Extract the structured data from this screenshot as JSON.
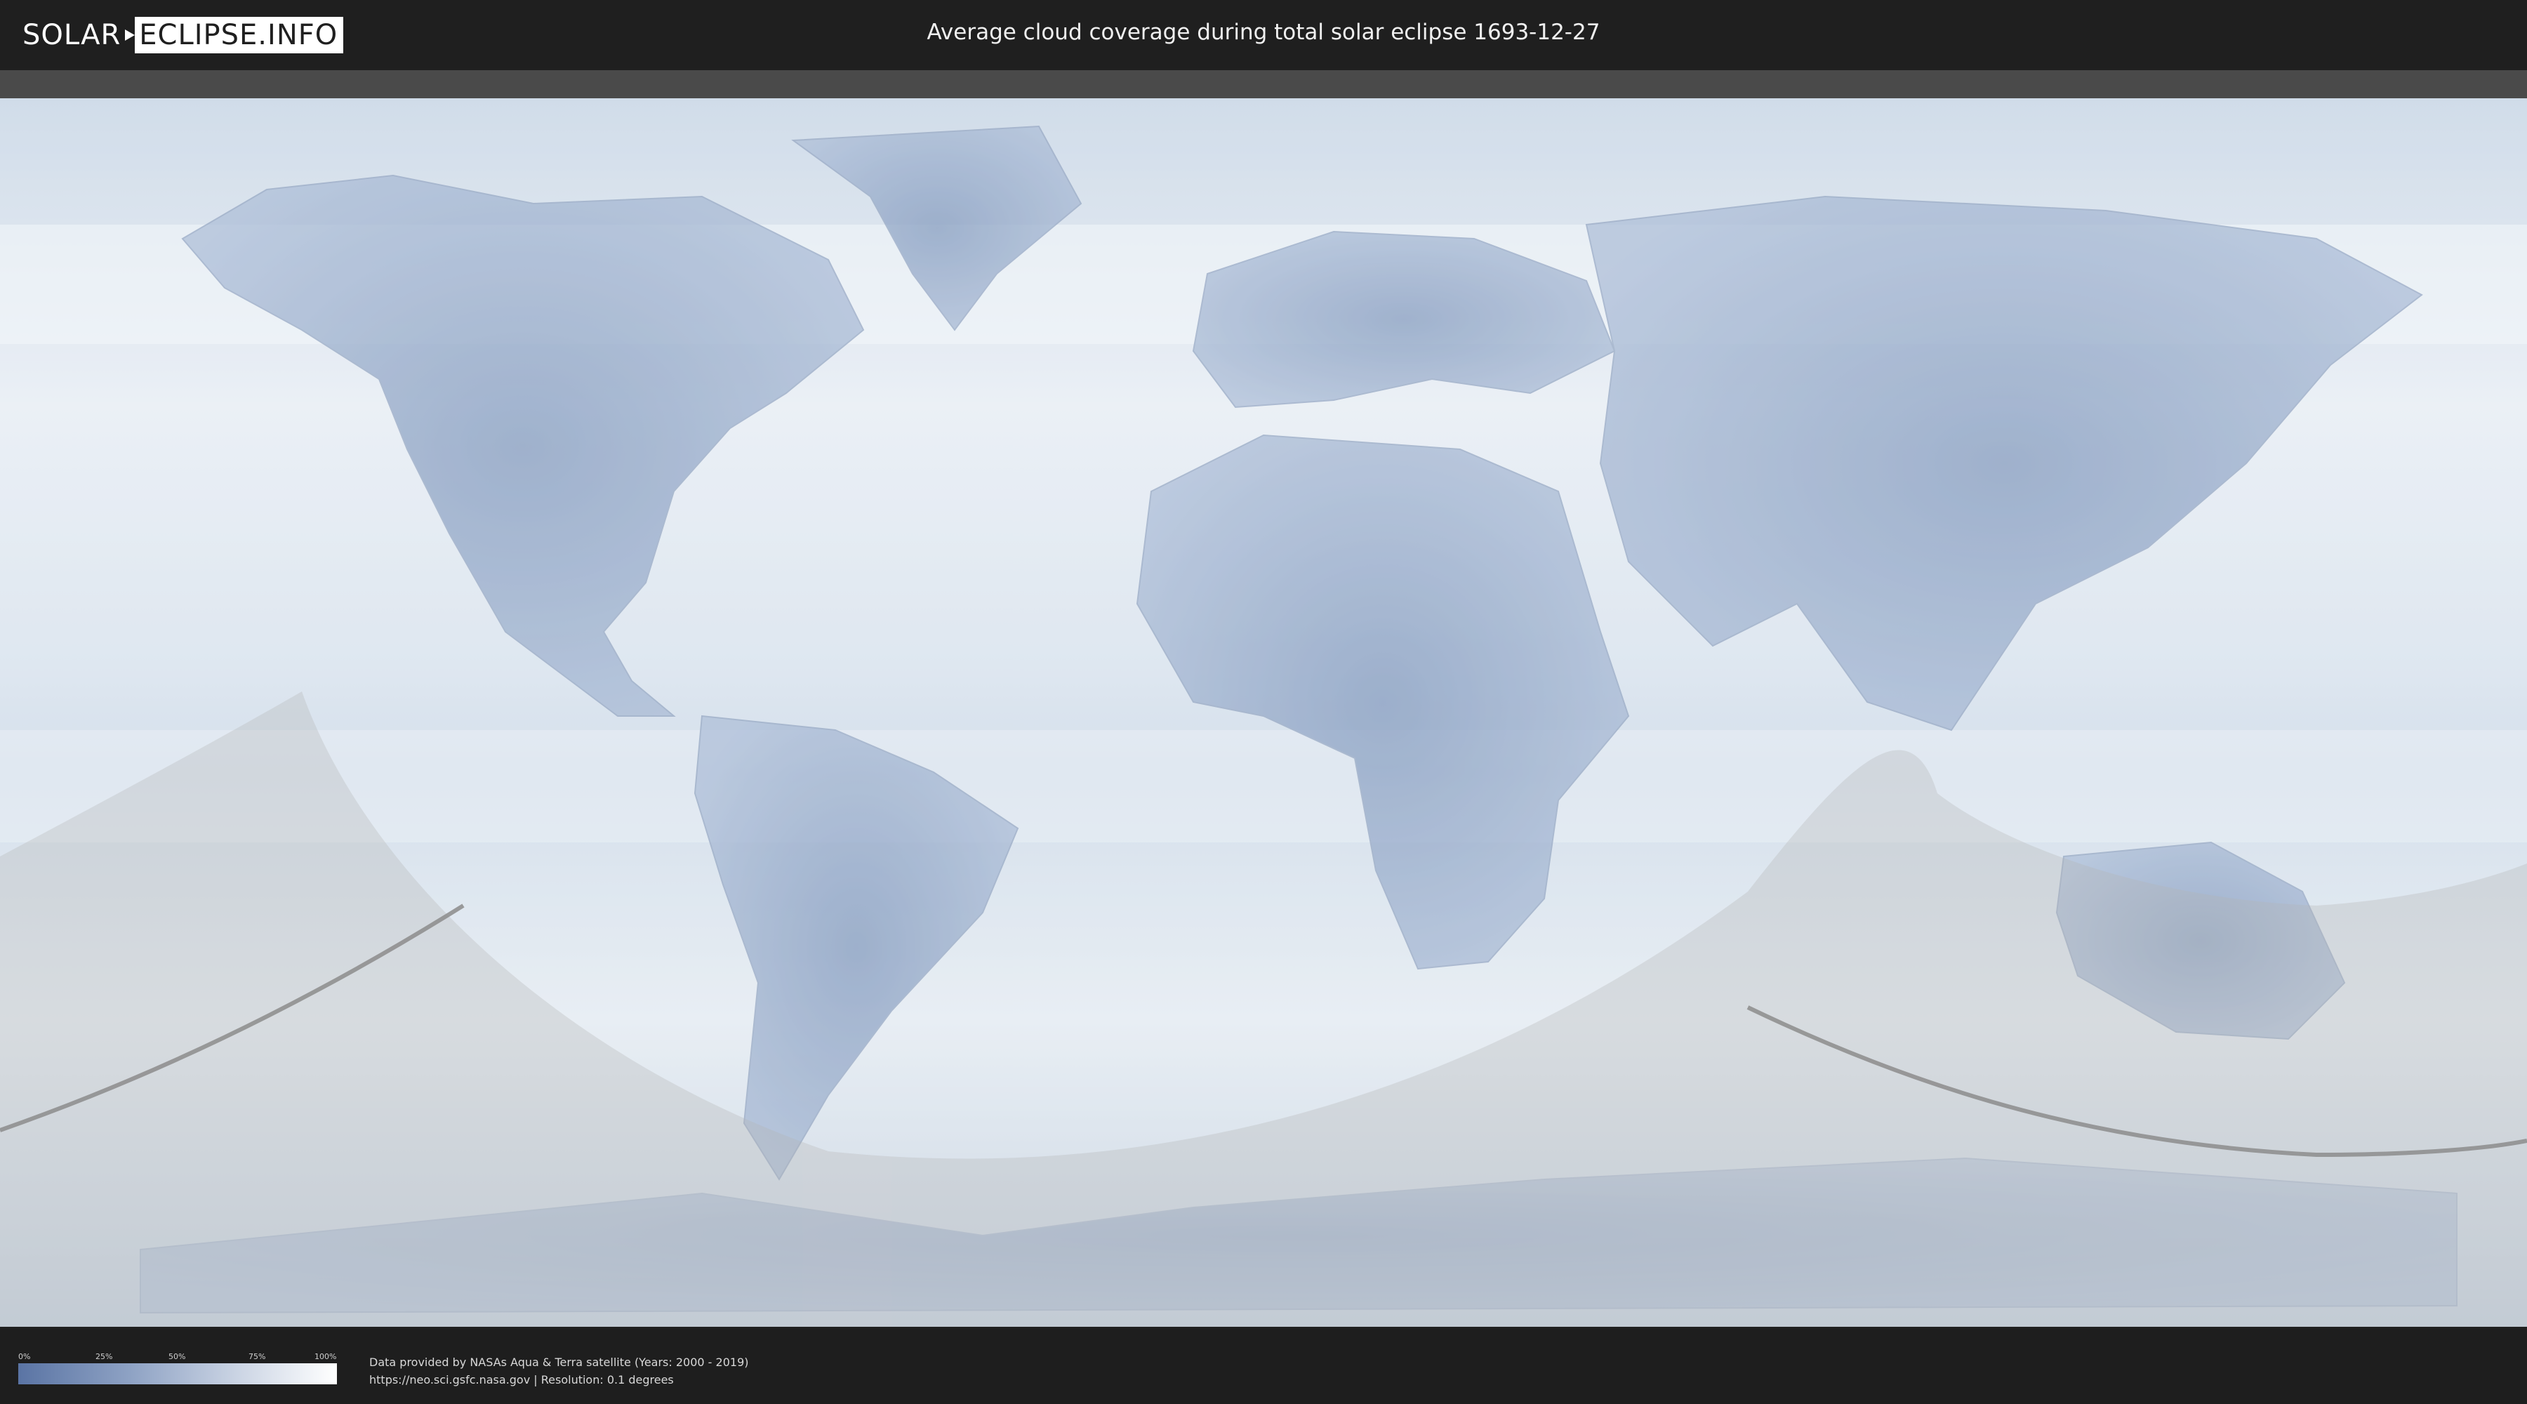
{
  "header": {
    "logo_left": "SOLAR",
    "logo_right": "ECLIPSE.INFO",
    "title": "Average cloud coverage during total solar eclipse 1693-12-27"
  },
  "legend": {
    "ticks": [
      "0%",
      "25%",
      "50%",
      "75%",
      "100%"
    ],
    "colors": {
      "low": "#5a74a4",
      "high": "#ffffff"
    }
  },
  "credits": {
    "line1": "Data provided by NASAs Aqua & Terra satellite (Years: 2000 - 2019)",
    "line2": "https://neo.sci.gsfc.nasa.gov | Resolution: 0.1 degrees"
  },
  "map": {
    "cloud_color": "#f4f7fb",
    "land_color": "#7d96bd",
    "shadow_color": "#b4b4b4",
    "path_color": "#8c8c8c"
  }
}
